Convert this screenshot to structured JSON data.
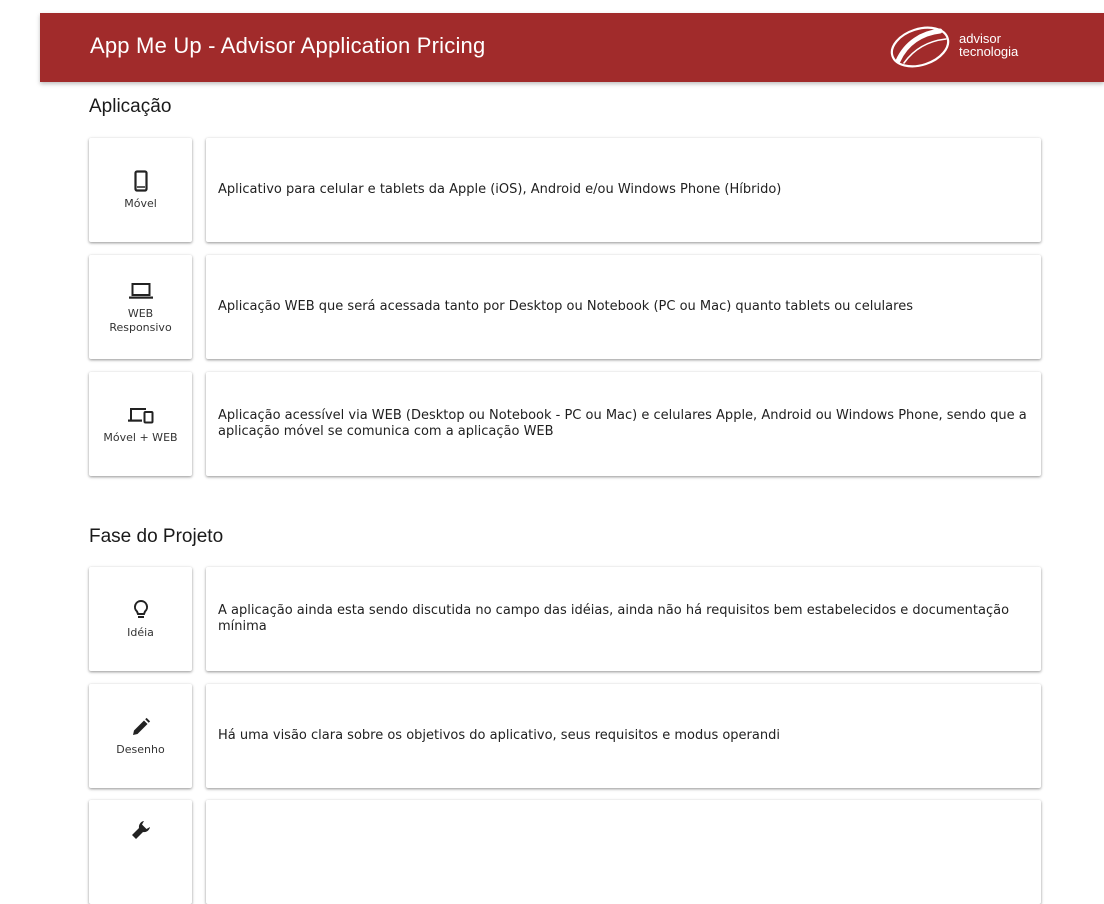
{
  "header": {
    "title": "App Me Up - Advisor Application Pricing",
    "logo_line1": "advisor",
    "logo_line2": "tecnologia",
    "background": "#a12b2b"
  },
  "sections": [
    {
      "title": "Aplicação",
      "options": [
        {
          "icon": "smartphone-icon",
          "label": "Móvel",
          "description": "Aplicativo para celular e tablets da Apple (iOS), Android e/ou Windows Phone (Híbrido)"
        },
        {
          "icon": "laptop-icon",
          "label": "WEB Responsivo",
          "description": "Aplicação WEB que será acessada tanto por Desktop ou Notebook (PC ou Mac) quanto tablets ou celulares"
        },
        {
          "icon": "devices-icon",
          "label": "Móvel + WEB",
          "description": "Aplicação acessível via WEB (Desktop ou Notebook - PC ou Mac) e celulares Apple, Android ou Windows Phone, sendo que a aplicação móvel se comunica com a aplicação WEB"
        }
      ]
    },
    {
      "title": "Fase do Projeto",
      "options": [
        {
          "icon": "lightbulb-icon",
          "label": "Idéia",
          "description": "A aplicação ainda esta sendo discutida no campo das idéias, ainda não há requisitos bem estabelecidos e documentação mínima"
        },
        {
          "icon": "pencil-icon",
          "label": "Desenho",
          "description": "Há uma visão clara sobre os objetivos do aplicativo, seus requisitos e modus operandi"
        },
        {
          "icon": "wrench-icon",
          "label": "",
          "description": ""
        }
      ]
    }
  ]
}
